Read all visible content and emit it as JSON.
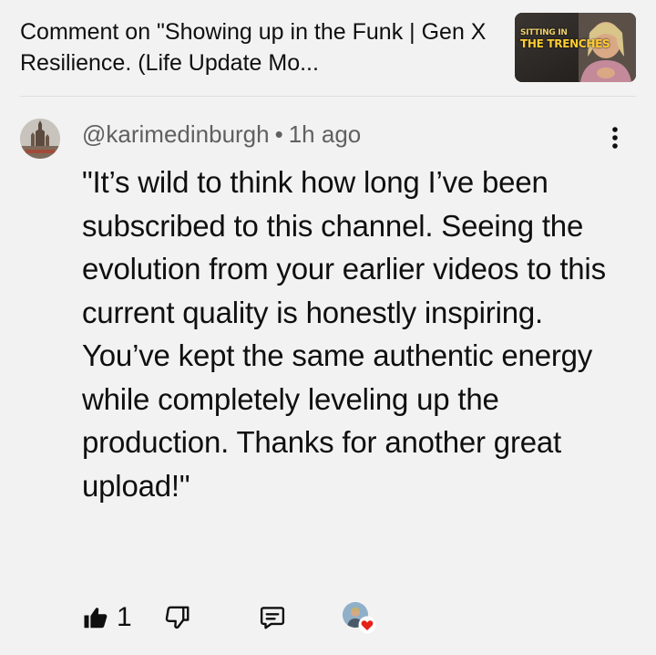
{
  "header": {
    "title": "Comment on \"Showing up in the Funk | Gen X Resilience.  (Life Update Mo...",
    "thumbnail": {
      "line1": "Sitting in",
      "line2": "The Trenches"
    }
  },
  "comment": {
    "author": "@karimedinburgh",
    "separator": "•",
    "time": "1h ago",
    "text": "\"It’s wild to think how long I’ve been subscribed to this channel. Seeing the evolution from your earlier videos to this current quality is honestly inspiring. You’ve kept the same authentic energy while completely leveling up the production. Thanks for another great upload!\""
  },
  "actions": {
    "like_count": "1",
    "icons": [
      "thumbs-up-icon",
      "thumbs-down-icon",
      "reply-icon",
      "creator-heart-icon",
      "more-options-icon"
    ]
  },
  "colors": {
    "background": "#f2f2f2",
    "text": "#0f0f0f",
    "secondary_text": "#606060",
    "heart": "#e62117",
    "thumbnail_title": "#e8b33a"
  }
}
